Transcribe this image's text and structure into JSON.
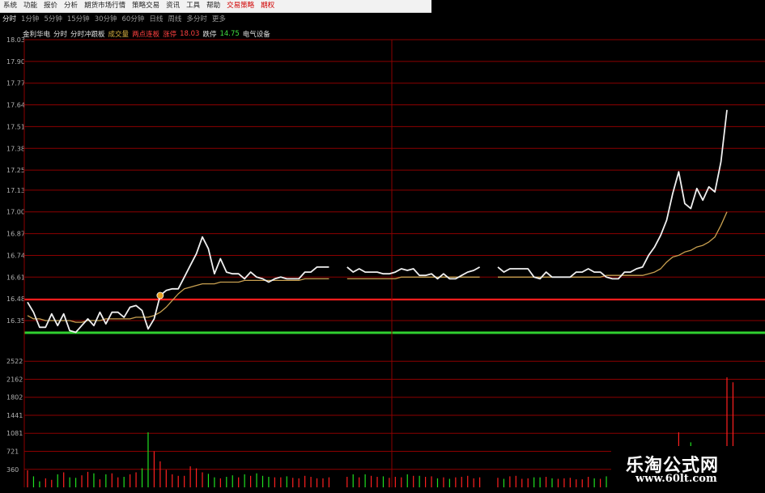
{
  "menu": [
    {
      "label": "系统"
    },
    {
      "label": "功能"
    },
    {
      "label": "报价"
    },
    {
      "label": "分析"
    },
    {
      "label": "期货市场行情"
    },
    {
      "label": "策略交易"
    },
    {
      "label": "资讯"
    },
    {
      "label": "工具"
    },
    {
      "label": "帮助"
    },
    {
      "label": "交易策略",
      "highlight": true
    },
    {
      "label": "期权",
      "highlight": true
    }
  ],
  "periods": [
    {
      "label": "分时",
      "active": true
    },
    {
      "label": "1分钟"
    },
    {
      "label": "5分钟"
    },
    {
      "label": "15分钟"
    },
    {
      "label": "30分钟"
    },
    {
      "label": "60分钟"
    },
    {
      "label": "日线"
    },
    {
      "label": "周线"
    },
    {
      "label": "多分时"
    },
    {
      "label": "更多"
    }
  ],
  "info": [
    {
      "text": "金利华电",
      "color": "#e0e0e0"
    },
    {
      "text": "分时",
      "color": "#e0e0e0"
    },
    {
      "text": "分时冲跟板",
      "color": "#e0e0e0"
    },
    {
      "text": "成交量",
      "color": "#d8b040"
    },
    {
      "text": "两点连板",
      "color": "#ff4040"
    },
    {
      "text": "涨停",
      "color": "#ff4040"
    },
    {
      "text": "18.03",
      "color": "#ff4040"
    },
    {
      "text": "跌停",
      "color": "#e0e0e0"
    },
    {
      "text": "14.75",
      "color": "#40e040"
    },
    {
      "text": "电气设备",
      "color": "#e0e0e0"
    }
  ],
  "colors": {
    "grid": "#8b0000",
    "up": "#ff2020",
    "down": "#20e020",
    "price": "#f0f0f0",
    "avg": "#c8a050",
    "axis_text": "#b0b0b0",
    "prev_close": "#30d030"
  },
  "chart_data": {
    "type": "line",
    "price_axis": {
      "ticks": [
        "18.03",
        "17.90",
        "17.77",
        "17.64",
        "17.51",
        "17.38",
        "17.25",
        "17.13",
        "17.00",
        "16.87",
        "16.74",
        "16.61",
        "16.48",
        "16.35"
      ],
      "ylim": [
        16.35,
        18.03
      ]
    },
    "volume_axis": {
      "ticks": [
        "2522",
        "2162",
        "1802",
        "1441",
        "1081",
        "721",
        "360"
      ],
      "ylim": [
        0,
        2882
      ]
    },
    "prev_close": 16.35,
    "series": [
      {
        "values": [
          16.46,
          16.4,
          16.31,
          16.31,
          16.39,
          16.32,
          16.39,
          16.29,
          16.28,
          16.32,
          16.36,
          16.32,
          16.4,
          16.33,
          16.4,
          16.4,
          16.37,
          16.43,
          16.44,
          16.41,
          16.3,
          16.36,
          16.5,
          16.53,
          16.54,
          16.54,
          16.61,
          16.68,
          16.75,
          16.85,
          16.78,
          16.63,
          16.72,
          16.64,
          16.63,
          16.63,
          16.6,
          16.64,
          16.61,
          16.6,
          16.58,
          16.6,
          16.61,
          16.6,
          16.6,
          16.6,
          16.64,
          16.64,
          16.67,
          16.67,
          16.67,
          null,
          null,
          16.67,
          16.64,
          16.66,
          16.64,
          16.64,
          16.64,
          16.63,
          16.63,
          16.64,
          16.66,
          16.65,
          16.66,
          16.62,
          16.62,
          16.63,
          16.6,
          16.63,
          16.6,
          16.6,
          16.62,
          16.64,
          16.65,
          16.67,
          null,
          null,
          16.67,
          16.64,
          16.66,
          16.66,
          16.66,
          16.66,
          16.61,
          16.6,
          16.64,
          16.61,
          16.61,
          16.61,
          16.61,
          16.64,
          16.64,
          16.66,
          16.64,
          16.64,
          16.61,
          16.6,
          16.6,
          16.64,
          16.64,
          16.66,
          16.67,
          16.74,
          16.79,
          16.86,
          16.95,
          17.11,
          17.24,
          17.05,
          17.02,
          17.14,
          17.07,
          17.15,
          17.12,
          17.3,
          17.61
        ]
      },
      {
        "values": [
          16.38,
          16.36,
          16.36,
          16.35,
          16.35,
          16.35,
          16.35,
          16.35,
          16.34,
          16.34,
          16.35,
          16.35,
          16.35,
          16.36,
          16.36,
          16.36,
          16.36,
          16.36,
          16.37,
          16.37,
          16.37,
          16.38,
          16.4,
          16.43,
          16.47,
          16.51,
          16.54,
          16.55,
          16.56,
          16.57,
          16.57,
          16.57,
          16.58,
          16.58,
          16.58,
          16.58,
          16.59,
          16.59,
          16.59,
          16.59,
          16.59,
          16.59,
          16.59,
          16.59,
          16.59,
          16.59,
          16.6,
          16.6,
          16.6,
          16.6,
          16.6,
          null,
          null,
          16.6,
          16.6,
          16.6,
          16.6,
          16.6,
          16.6,
          16.6,
          16.6,
          16.6,
          16.61,
          16.61,
          16.61,
          16.61,
          16.61,
          16.61,
          16.61,
          16.61,
          16.61,
          16.61,
          16.61,
          16.61,
          16.61,
          16.61,
          null,
          null,
          16.61,
          16.61,
          16.61,
          16.61,
          16.61,
          16.61,
          16.61,
          16.61,
          16.61,
          16.61,
          16.61,
          16.61,
          16.61,
          16.61,
          16.61,
          16.61,
          16.61,
          16.61,
          16.62,
          16.62,
          16.62,
          16.62,
          16.62,
          16.62,
          16.62,
          16.63,
          16.64,
          16.66,
          16.7,
          16.73,
          16.74,
          16.76,
          16.77,
          16.79,
          16.8,
          16.82,
          16.85,
          16.92,
          17.0
        ]
      }
    ],
    "volumes": [
      340,
      220,
      120,
      180,
      150,
      260,
      300,
      200,
      190,
      240,
      310,
      280,
      160,
      260,
      280,
      200,
      210,
      260,
      300,
      380,
      1100,
      720,
      520,
      350,
      260,
      230,
      230,
      420,
      380,
      300,
      270,
      200,
      180,
      210,
      240,
      200,
      260,
      230,
      280,
      230,
      210,
      200,
      200,
      220,
      190,
      180,
      230,
      210,
      180,
      180,
      200,
      0,
      0,
      210,
      260,
      200,
      260,
      230,
      210,
      220,
      190,
      210,
      200,
      260,
      230,
      230,
      210,
      220,
      180,
      200,
      170,
      200,
      210,
      230,
      180,
      200,
      0,
      0,
      190,
      170,
      220,
      230,
      170,
      180,
      200,
      200,
      210,
      180,
      170,
      180,
      190,
      160,
      160,
      210,
      180,
      170,
      220,
      200,
      180,
      190,
      300,
      300,
      210,
      220,
      200,
      220,
      280,
      600,
      1100,
      700,
      900,
      800,
      500,
      400,
      600,
      400,
      2200,
      2100
    ]
  },
  "watermark": {
    "title": "乐淘公式网",
    "url": "www.60lt.com"
  }
}
